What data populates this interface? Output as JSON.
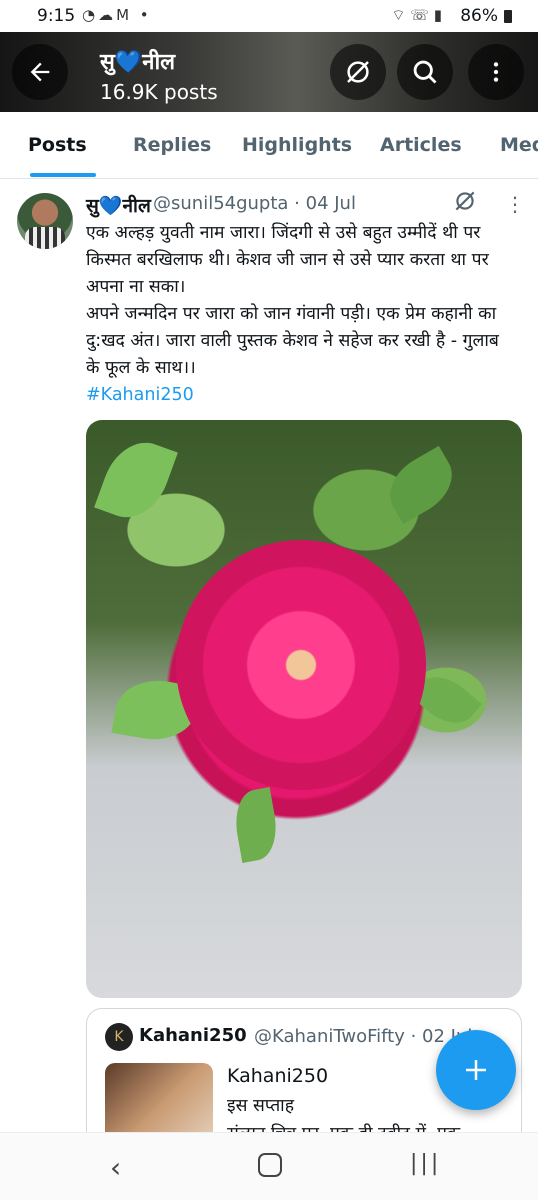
{
  "status_bar": {
    "time": "9:15",
    "battery": "86%"
  },
  "header": {
    "title": "सु💙नील",
    "posts_count": "16.9K posts"
  },
  "tabs": [
    {
      "label": "Posts",
      "active": true
    },
    {
      "label": "Replies"
    },
    {
      "label": "Highlights"
    },
    {
      "label": "Articles"
    },
    {
      "label": "Med"
    }
  ],
  "post": {
    "author_name": "सु💙नील",
    "meta": "@sunil54gupta · 04 Jul",
    "body_p1": "एक अल्हड़ युवती नाम जारा। जिंदगी से उसे बहुत उम्मीदें थी पर किस्मत बरखिलाफ थी। केशव जी जान से उसे प्यार करता था पर अपना ना सका।",
    "body_p2": "अपने जन्मदिन पर जारा को जान गंवानी पड़ी। एक प्रेम कहानी का दु:खद अंत। जारा वाली पुस्तक केशव ने सहेज कर रखी है - गुलाब के फूल के साथ।।",
    "hashtag": "#Kahani250"
  },
  "quote": {
    "avatar_letter": "K",
    "name": "Kahani250",
    "handle": "@KahaniTwoFifty · 02 Jul",
    "title": "Kahani250",
    "line1": "इस सप्ताह",
    "line2": "संलग्न चित्र पर, एक ही ट्वीट में, एक"
  },
  "colors": {
    "accent": "#1d9bf0",
    "text": "#0f1419",
    "muted": "#536471"
  }
}
